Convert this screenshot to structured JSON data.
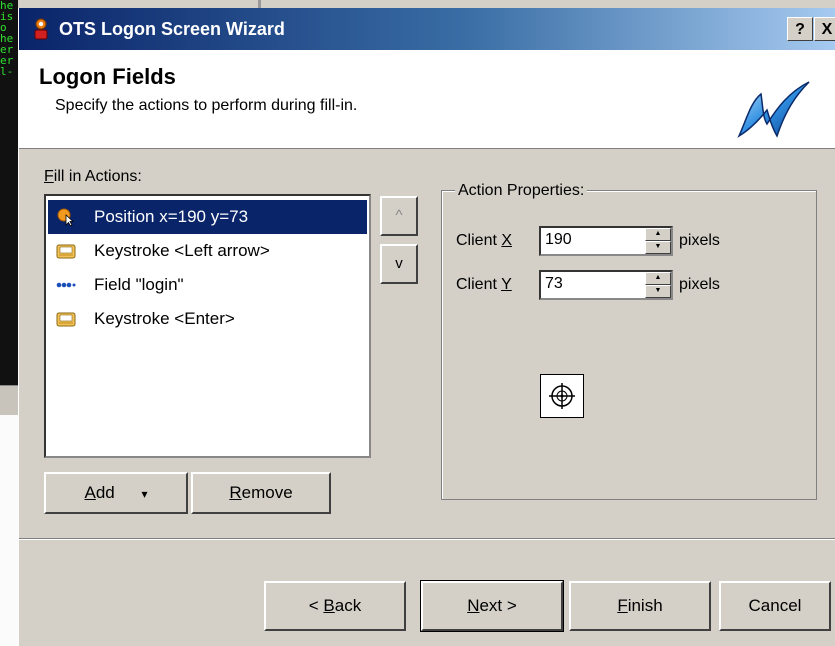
{
  "background": {
    "terminal_lines": [
      "he",
      "is",
      "",
      "",
      "o",
      "he",
      "er",
      "",
      "er",
      "",
      "",
      "l-"
    ]
  },
  "window": {
    "title": "OTS Logon Screen Wizard",
    "help_button": "?",
    "close_button": "X"
  },
  "header": {
    "title": "Logon Fields",
    "subtitle": "Specify the actions to perform during fill-in."
  },
  "fill_in": {
    "label_accel": "F",
    "label_rest": "ill in Actions:",
    "items": [
      {
        "label": "Position x=190 y=73",
        "icon": "cursor-icon",
        "selected": true
      },
      {
        "label": "Keystroke <Left arrow>",
        "icon": "keyboard-icon",
        "selected": false
      },
      {
        "label": "Field \"login\"",
        "icon": "field-icon",
        "selected": false
      },
      {
        "label": "Keystroke <Enter>",
        "icon": "keyboard-icon",
        "selected": false
      }
    ],
    "move_up": "^",
    "move_down": "v",
    "add_accel": "A",
    "add_rest": "dd",
    "add_arrow": "▾",
    "remove_accel": "R",
    "remove_rest": "emove"
  },
  "properties": {
    "title": "Action Properties:",
    "client_x_label": "Client ",
    "client_x_accel": "X",
    "client_x_value": "190",
    "client_y_label": "Client ",
    "client_y_accel": "Y",
    "client_y_value": "73",
    "unit": "pixels"
  },
  "nav": {
    "back_prefix": "< ",
    "back_accel": "B",
    "back_rest": "ack",
    "next_accel": "N",
    "next_rest": "ext >",
    "finish_accel": "F",
    "finish_rest": "inish",
    "cancel": "Cancel"
  },
  "colors": {
    "title_bar_start": "#0a246a",
    "selection": "#0a246a",
    "dialog_face": "#d4d0c8",
    "terminal_text": "#2fe02f"
  }
}
